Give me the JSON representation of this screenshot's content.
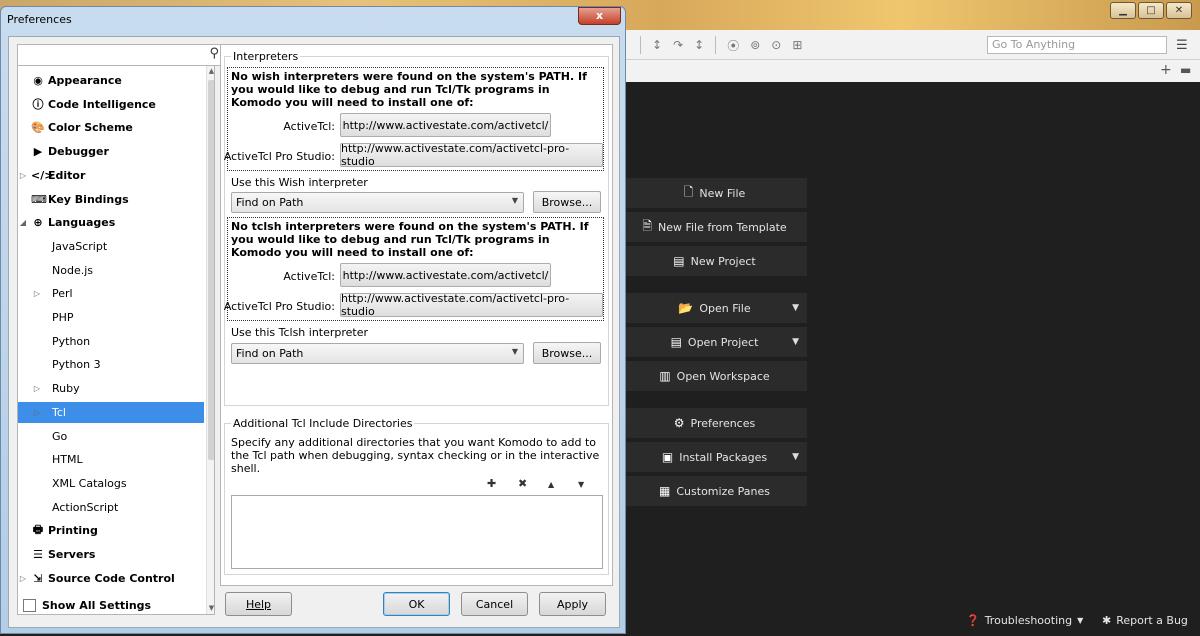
{
  "komodo": {
    "goto_placeholder": "Go To Anything",
    "start_buttons": [
      {
        "icon": "new-file-icon",
        "glyph": "🗋",
        "label": "New File"
      },
      {
        "icon": "template-icon",
        "glyph": "🗎",
        "label": "New File from Template"
      },
      {
        "icon": "new-project-icon",
        "glyph": "▤",
        "label": "New Project"
      },
      {
        "icon": "open-folder-icon",
        "glyph": "📂",
        "label": "Open File"
      },
      {
        "icon": "project-icon",
        "glyph": "▤",
        "label": "Open Project"
      },
      {
        "icon": "workspace-icon",
        "glyph": "▥",
        "label": "Open Workspace"
      },
      {
        "icon": "gear-icon",
        "glyph": "⚙",
        "label": "Preferences"
      },
      {
        "icon": "package-icon",
        "glyph": "▣",
        "label": "Install Packages"
      },
      {
        "icon": "grid-icon",
        "glyph": "▦",
        "label": "Customize Panes"
      }
    ],
    "status": {
      "troubleshooting": "Troubleshooting",
      "report_bug": "Report a Bug"
    }
  },
  "dialog": {
    "title": "Preferences",
    "close_label": "x",
    "tree": [
      {
        "label": "Appearance",
        "glyph": "◉",
        "bold": true,
        "expander": ""
      },
      {
        "label": "Code Intelligence",
        "glyph": "ⓘ",
        "bold": true,
        "expander": ""
      },
      {
        "label": "Color Scheme",
        "glyph": "🎨",
        "bold": true,
        "expander": ""
      },
      {
        "label": "Debugger",
        "glyph": "▶",
        "bold": true,
        "expander": ""
      },
      {
        "label": "Editor",
        "glyph": "</>",
        "bold": true,
        "expander": "▷"
      },
      {
        "label": "Key Bindings",
        "glyph": "⌨",
        "bold": true,
        "expander": ""
      },
      {
        "label": "Languages",
        "glyph": "⊕",
        "bold": true,
        "expander": "◢"
      },
      {
        "label": "JavaScript",
        "glyph": "",
        "bold": false,
        "expander": ""
      },
      {
        "label": "Node.js",
        "glyph": "",
        "bold": false,
        "expander": ""
      },
      {
        "label": "Perl",
        "glyph": "",
        "bold": false,
        "expander": "▷"
      },
      {
        "label": "PHP",
        "glyph": "",
        "bold": false,
        "expander": ""
      },
      {
        "label": "Python",
        "glyph": "",
        "bold": false,
        "expander": ""
      },
      {
        "label": "Python 3",
        "glyph": "",
        "bold": false,
        "expander": ""
      },
      {
        "label": "Ruby",
        "glyph": "",
        "bold": false,
        "expander": "▷"
      },
      {
        "label": "Tcl",
        "glyph": "",
        "bold": false,
        "expander": "▷",
        "selected": true
      },
      {
        "label": "Go",
        "glyph": "",
        "bold": false,
        "expander": ""
      },
      {
        "label": "HTML",
        "glyph": "",
        "bold": false,
        "expander": ""
      },
      {
        "label": "XML Catalogs",
        "glyph": "",
        "bold": false,
        "expander": ""
      },
      {
        "label": "ActionScript",
        "glyph": "",
        "bold": false,
        "expander": ""
      },
      {
        "label": "Printing",
        "glyph": "🖶",
        "bold": true,
        "expander": ""
      },
      {
        "label": "Servers",
        "glyph": "☰",
        "bold": true,
        "expander": ""
      },
      {
        "label": "Source Code Control",
        "glyph": "⇲",
        "bold": true,
        "expander": "▷"
      }
    ],
    "interpreters": {
      "title": "Interpreters",
      "wish_warning": "No wish interpreters were found on the system's PATH. If you would like to debug and run Tcl/Tk programs in Komodo you will need to install one of:",
      "tclsh_warning": "No tclsh interpreters were found on the system's PATH. If you would like to debug and run Tcl/Tk programs in Komodo you will need to install one of:",
      "activetcl_label": "ActiveTcl:",
      "activetcl_url": "http://www.activestate.com/activetcl/",
      "pro_label": "ActiveTcl Pro Studio:",
      "pro_url": "http://www.activestate.com/activetcl-pro-studio",
      "wish_label": "Use this Wish interpreter",
      "tclsh_label": "Use this Tclsh interpreter",
      "wish_value": "Find on Path",
      "tclsh_value": "Find on Path",
      "browse": "Browse..."
    },
    "include_dirs": {
      "title": "Additional Tcl Include Directories",
      "description": "Specify any additional directories that you want Komodo to add to the Tcl path when debugging, syntax checking or in the interactive shell."
    },
    "show_all": "Show All Settings",
    "buttons": {
      "help": "Help",
      "ok": "OK",
      "cancel": "Cancel",
      "apply": "Apply"
    }
  }
}
